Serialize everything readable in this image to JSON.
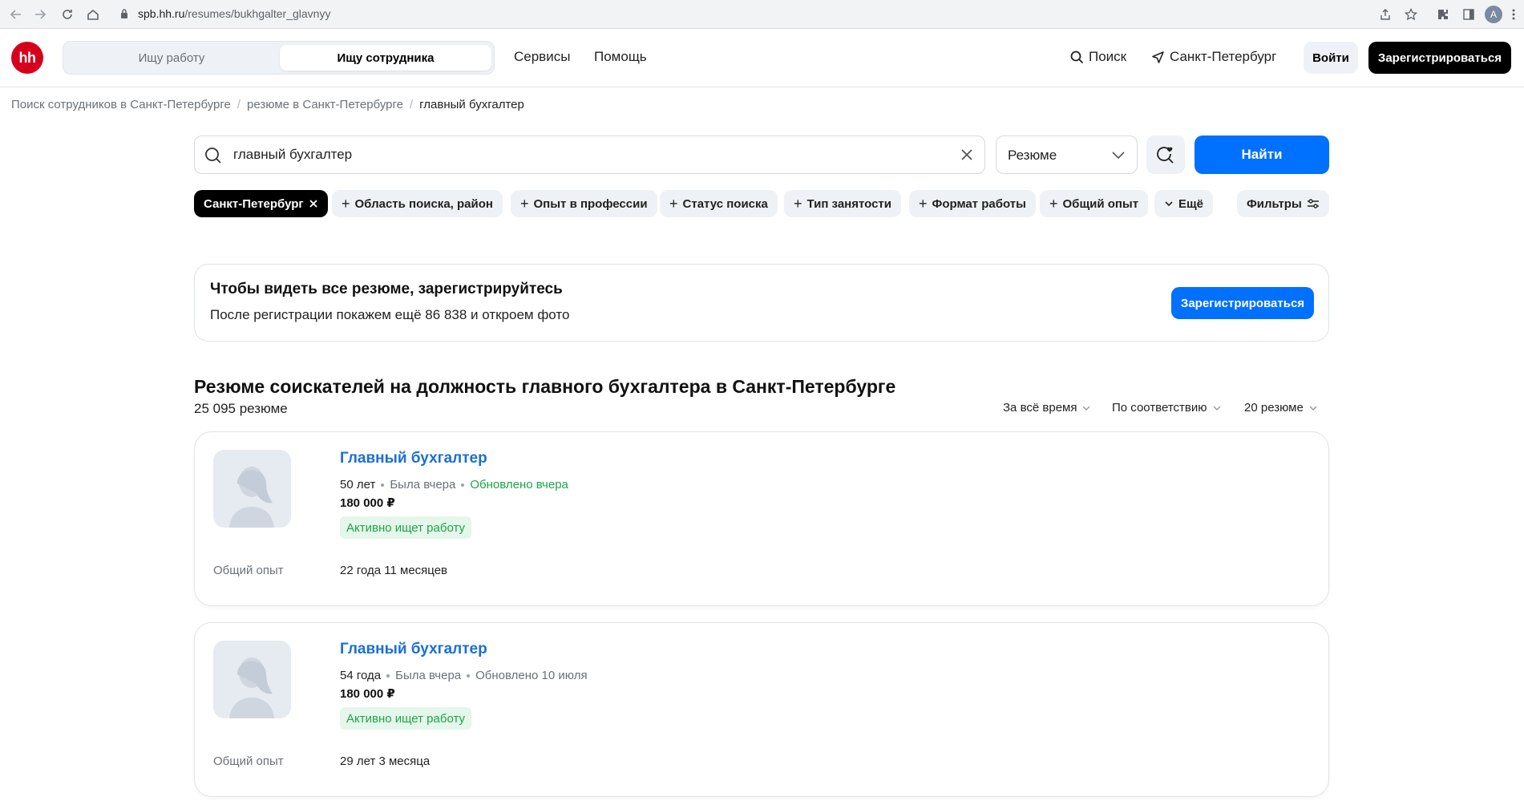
{
  "browser": {
    "url_host": "spb.hh.ru",
    "url_path": "/resumes/bukhgalter_glavnyy",
    "profile_initial": "A"
  },
  "header": {
    "logo_text": "hh",
    "segment_left": "Ищу работу",
    "segment_right": "Ищу сотрудника",
    "nav_services": "Сервисы",
    "nav_help": "Помощь",
    "search_label": "Поиск",
    "city_label": "Санкт-Петербург",
    "login_label": "Войти",
    "register_label": "Зарегистрироваться"
  },
  "breadcrumbs": {
    "item1": "Поиск сотрудников в Санкт-Петербурге",
    "item2": "резюме в Санкт-Петербурге",
    "item3": "главный бухгалтер",
    "separator": "/"
  },
  "search": {
    "query": "главный бухгалтер",
    "type_select": "Резюме",
    "find_label": "Найти"
  },
  "chips": {
    "city": "Санкт-Петербург",
    "area": "Область поиска, район",
    "experience_prof": "Опыт в профессии",
    "status": "Статус поиска",
    "employment": "Тип занятости",
    "work_format": "Формат работы",
    "total_exp": "Общий опыт",
    "more": "Ещё",
    "filters": "Фильтры"
  },
  "banner": {
    "title": "Чтобы видеть все резюме, зарегистрируйтесь",
    "subtitle": "После регистрации покажем ещё 86 838 и откроем фото",
    "button": "Зарегистрироваться"
  },
  "results": {
    "title": "Резюме соискателей на должность главного бухгалтера в Санкт-Петербурге",
    "count": "25 095 резюме",
    "sort_period": "За всё время",
    "sort_order": "По соответствию",
    "sort_per_page": "20 резюме"
  },
  "resumes": [
    {
      "title": "Главный бухгалтер",
      "age": "50 лет",
      "last_seen": "Была вчера",
      "updated": "Обновлено вчера",
      "salary": "180 000 ₽",
      "status": "Активно ищет работу",
      "exp_label": "Общий опыт",
      "exp_value": "22 года 11 месяцев"
    },
    {
      "title": "Главный бухгалтер",
      "age": "54 года",
      "last_seen": "Была вчера",
      "updated": "Обновлено 10 июля",
      "salary": "180 000 ₽",
      "status": "Активно ищет работу",
      "exp_label": "Общий опыт",
      "exp_value": "29 лет 3 месяца"
    }
  ],
  "colors": {
    "brand_red": "#d6001c",
    "primary_blue": "#0070ff",
    "link_blue": "#1a6fd6",
    "success_green": "#1ea44b"
  }
}
